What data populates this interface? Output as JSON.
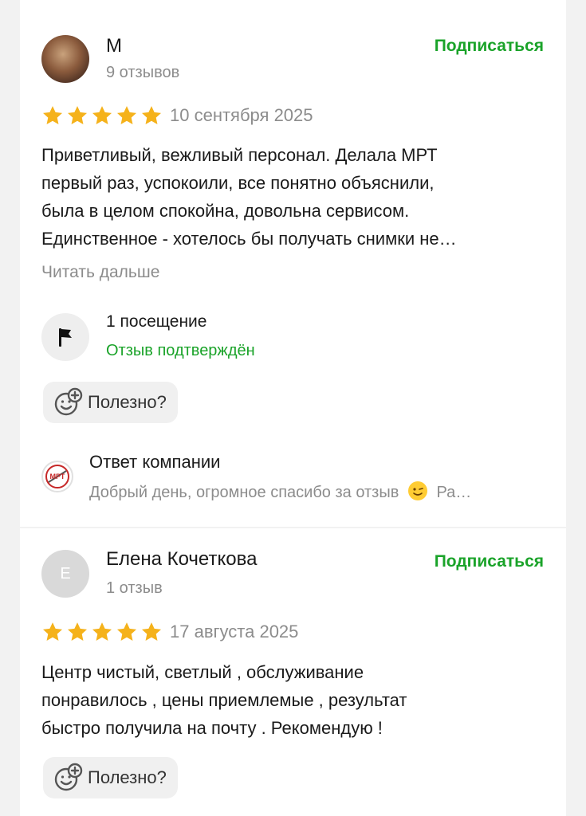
{
  "reviews": [
    {
      "author_name": "М",
      "author_reviews": "9 отзывов",
      "subscribe_label": "Подписаться",
      "rating": 5,
      "date": "10 сентября 2025",
      "text_lines": [
        "Приветливый, вежливый персонал. Делала МРТ",
        "первый раз, успокоили, все понятно объяснили,",
        "была в целом спокойна, довольна сервисом.",
        "Единственное - хотелось бы получать снимки не…"
      ],
      "read_more": "Читать дальше",
      "visits": "1 посещение",
      "verified": "Отзыв подтверждён",
      "useful_label": "Полезно?",
      "reply": {
        "logo_text": "МРТ",
        "title": "Ответ компании",
        "preview_before": "Добрый день, огромное спасибо за отзыв",
        "preview_after": "Ра…"
      }
    },
    {
      "author_initial": "Е",
      "author_name": "Елена Кочеткова",
      "author_reviews": "1 отзыв",
      "subscribe_label": "Подписаться",
      "rating": 5,
      "date": "17 августа 2025",
      "text_lines": [
        "Центр чистый, светлый , обслуживание",
        "понравилось , цены приемлемые , результат",
        "быстро получила на почту . Рекомендую !"
      ],
      "useful_label": "Полезно?"
    }
  ],
  "colors": {
    "accent_green": "#1aa329",
    "star_yellow": "#f5b21b",
    "muted_text": "#8c8c8c"
  },
  "icons": [
    "star-icon",
    "flag-icon",
    "smiley-plus-icon",
    "company-logo-icon",
    "wink-emoji-icon"
  ]
}
